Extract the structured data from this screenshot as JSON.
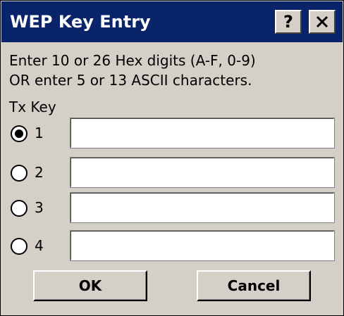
{
  "dialog": {
    "title": "WEP Key Entry",
    "help_label": "?",
    "close_icon": "close-icon",
    "colors": {
      "titlebar": "#0a246a",
      "face": "#d4d0c8",
      "title_text": "#ffffff"
    }
  },
  "instructions": {
    "line1": "Enter 10 or 26 Hex digits (A-F, 0-9)",
    "line2": "OR enter 5 or 13 ASCII characters."
  },
  "tx_key": {
    "label": "Tx Key",
    "selected": 1,
    "keys": [
      {
        "label": "1",
        "value": ""
      },
      {
        "label": "2",
        "value": ""
      },
      {
        "label": "3",
        "value": ""
      },
      {
        "label": "4",
        "value": ""
      }
    ]
  },
  "buttons": {
    "ok_label": "OK",
    "cancel_label": "Cancel"
  }
}
